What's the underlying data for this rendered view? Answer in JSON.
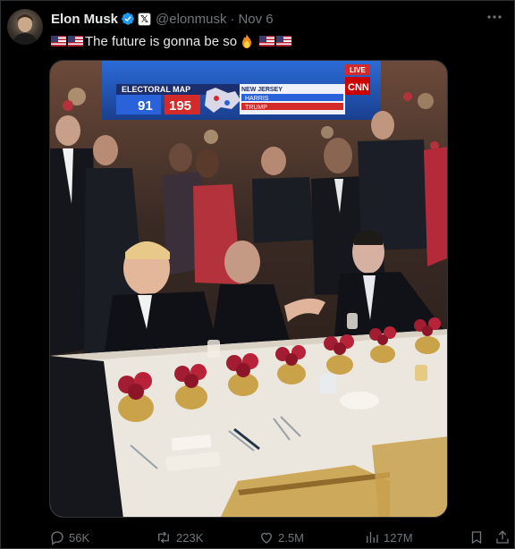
{
  "author": {
    "name": "Elon Musk",
    "handle": "@elonmusk",
    "date": "Nov 6",
    "separator": "·",
    "verified": true,
    "affiliation_badge": "𝕏"
  },
  "tweet": {
    "text": "The future is gonna be so"
  },
  "media": {
    "tv": {
      "network": "CNN",
      "live_label": "LIVE",
      "banner": "ELECTORAL MAP",
      "harris_ev": "91",
      "trump_ev": "195",
      "state": "NEW JERSEY",
      "rows": [
        "HARRIS",
        "TRUMP"
      ]
    }
  },
  "stats": {
    "replies": "56K",
    "reposts": "223K",
    "likes": "2.5M",
    "views": "127M"
  },
  "colors": {
    "accent": "#1d9bf0",
    "muted": "#71767b",
    "text": "#e7e9ea",
    "background": "#000000"
  },
  "icons": [
    "verified-badge-icon",
    "x-affiliation-icon",
    "more-icon",
    "fire-icon",
    "us-flag-icon",
    "reply-icon",
    "repost-icon",
    "like-icon",
    "views-icon",
    "bookmark-icon",
    "share-icon"
  ]
}
